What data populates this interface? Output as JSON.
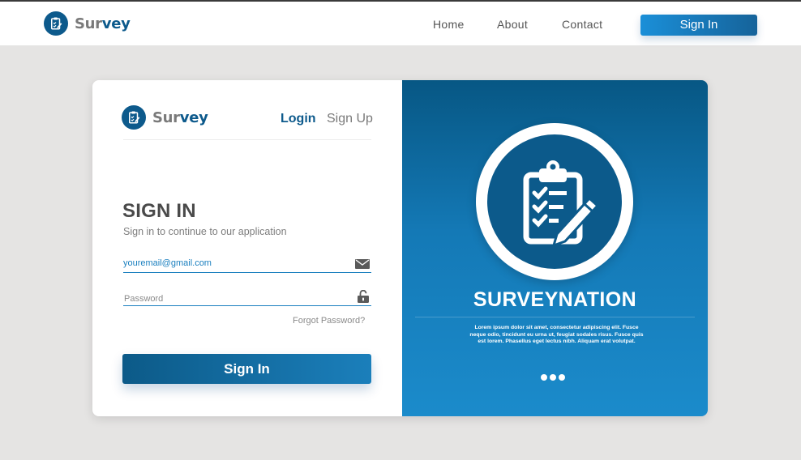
{
  "colors": {
    "brand": "#0d5a8c",
    "accent": "#1a8fd8",
    "page_bg": "#e5e4e3"
  },
  "nav": {
    "logo": {
      "icon": "clipboard-edit-icon",
      "text_a": "Sur",
      "text_b": "vey"
    },
    "links": [
      "Home",
      "About",
      "Contact"
    ],
    "signin_label": "Sign In"
  },
  "card": {
    "logo": {
      "icon": "clipboard-edit-icon",
      "text_a": "Sur",
      "text_b": "vey"
    },
    "tabs": {
      "login": "Login",
      "signup": "Sign Up"
    },
    "heading": "SIGN IN",
    "subheading": "Sign in to continue to our application",
    "email": {
      "value": "youremail@gmail.com",
      "icon": "envelope-icon"
    },
    "password": {
      "placeholder": "Password",
      "icon": "unlock-icon"
    },
    "forgot": "Forgot Password?",
    "submit": "Sign In"
  },
  "hero": {
    "icon": "clipboard-checklist-pencil-icon",
    "title": "SURVEYNATION",
    "body": "Lorem ipsum dolor sit amet, consectetur adipiscing elit. Fusce neque odio, tincidunt eu urna ut, feugiat sodales risus. Fusce quis est lorem. Phasellus eget lectus nibh. Aliquam erat volutpat.",
    "carousel_dots": 3
  }
}
